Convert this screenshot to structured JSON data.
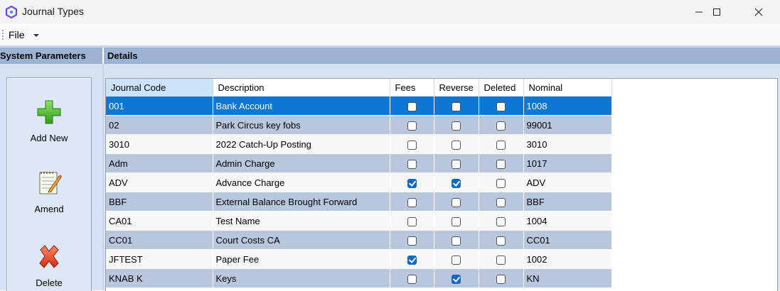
{
  "window": {
    "title": "Journal Types"
  },
  "menu": {
    "file_label": "File"
  },
  "sections": {
    "left": "System Parameters",
    "right": "Details"
  },
  "toolbar": [
    {
      "label": "Add New",
      "icon": "plus-icon"
    },
    {
      "label": "Amend",
      "icon": "notepad-pencil-icon"
    },
    {
      "label": "Delete",
      "icon": "red-x-icon"
    }
  ],
  "columns": [
    "Journal Code",
    "Description",
    "Fees",
    "Reverse",
    "Deleted",
    "Nominal"
  ],
  "rows": [
    {
      "code": "001",
      "description": "Bank Account",
      "fees": false,
      "reverse": false,
      "deleted": false,
      "nominal": "1008",
      "selected": true
    },
    {
      "code": "02",
      "description": "Park Circus key fobs",
      "fees": false,
      "reverse": false,
      "deleted": false,
      "nominal": "99001"
    },
    {
      "code": "3010",
      "description": "2022 Catch-Up Posting",
      "fees": false,
      "reverse": false,
      "deleted": false,
      "nominal": "3010"
    },
    {
      "code": "Adm",
      "description": "Admin Charge",
      "fees": false,
      "reverse": false,
      "deleted": false,
      "nominal": "1017"
    },
    {
      "code": "ADV",
      "description": "Advance Charge",
      "fees": true,
      "reverse": true,
      "deleted": false,
      "nominal": "ADV"
    },
    {
      "code": "BBF",
      "description": "External Balance Brought Forward",
      "fees": false,
      "reverse": false,
      "deleted": false,
      "nominal": "BBF"
    },
    {
      "code": "CA01",
      "description": "Test Name",
      "fees": false,
      "reverse": false,
      "deleted": false,
      "nominal": "1004"
    },
    {
      "code": "CC01",
      "description": "Court Costs CA",
      "fees": false,
      "reverse": false,
      "deleted": false,
      "nominal": "CC01"
    },
    {
      "code": "JFTEST",
      "description": "Paper Fee",
      "fees": true,
      "reverse": false,
      "deleted": false,
      "nominal": "1002"
    },
    {
      "code": "KNAB K",
      "description": "Keys",
      "fees": false,
      "reverse": true,
      "deleted": false,
      "nominal": "KN"
    }
  ],
  "colors": {
    "selected_row": "#0c78d4",
    "alt_row": "#b8c6de",
    "header_band": "#9db3d4"
  }
}
